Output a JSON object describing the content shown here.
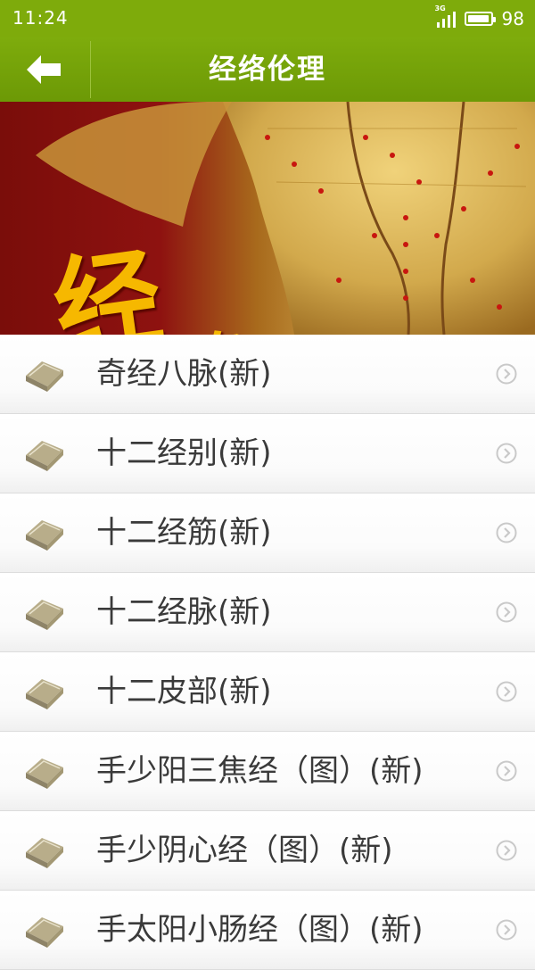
{
  "status_bar": {
    "time": "11:24",
    "network": "3G",
    "battery": "98",
    "battery_level": 0.98
  },
  "title_bar": {
    "title": "经络伦理",
    "back_icon": "arrow-left-icon"
  },
  "banner": {
    "calligraphy_big": "经",
    "calligraphy_small": "络"
  },
  "items": [
    {
      "label": "奇经八脉(新)"
    },
    {
      "label": "十二经别(新)"
    },
    {
      "label": "十二经筋(新)"
    },
    {
      "label": "十二经脉(新)"
    },
    {
      "label": "十二皮部(新)"
    },
    {
      "label": "手少阳三焦经（图）(新)"
    },
    {
      "label": "手少阴心经（图）(新)"
    },
    {
      "label": "手太阳小肠经（图）(新)"
    }
  ],
  "colors": {
    "accent": "#7eab0b",
    "text": "#3a3a3a"
  }
}
